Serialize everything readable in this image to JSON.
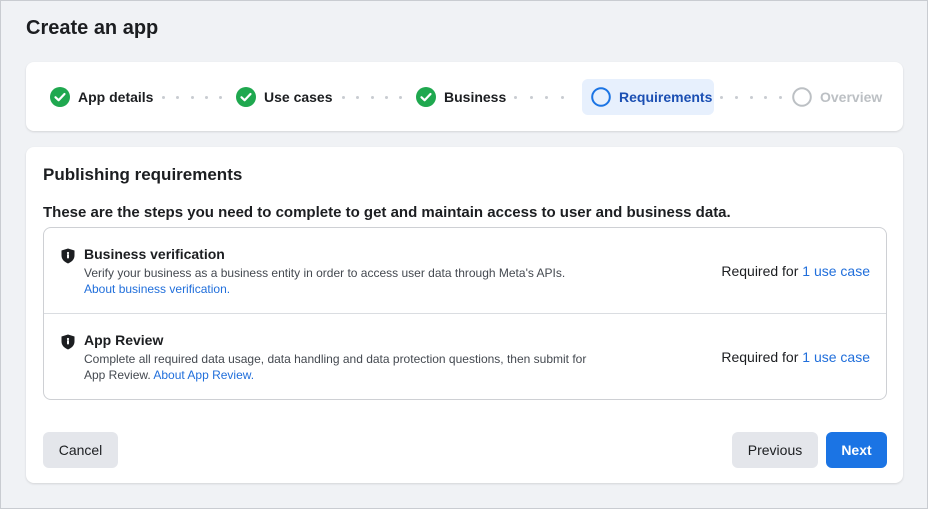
{
  "page": {
    "title": "Create an app"
  },
  "steps": [
    {
      "label": "App details",
      "state": "complete"
    },
    {
      "label": "Use cases",
      "state": "complete"
    },
    {
      "label": "Business",
      "state": "complete"
    },
    {
      "label": "Requirements",
      "state": "active"
    },
    {
      "label": "Overview",
      "state": "pending"
    }
  ],
  "card": {
    "title": "Publishing requirements",
    "subtitle": "These are the steps you need to complete to get and maintain access to user and business data.",
    "requirements": [
      {
        "title": "Business verification",
        "desc_line1": "Verify your business as a business entity in order to access user data through Meta's APIs.",
        "desc_prefix": "",
        "link": "About business verification.",
        "status_prefix": "Required for ",
        "status_link": "1 use case"
      },
      {
        "title": "App Review",
        "desc_line1": "Complete all required data usage, data handling and data protection questions, then submit for",
        "desc_prefix": "App Review. ",
        "link": "About App Review.",
        "status_prefix": "Required for ",
        "status_link": "1 use case"
      }
    ]
  },
  "buttons": {
    "cancel": "Cancel",
    "previous": "Previous",
    "next": "Next"
  },
  "colors": {
    "accent": "#1b74e4",
    "complete": "#1fa84f",
    "link": "#216fdb",
    "active_bg": "#e7f0fd"
  },
  "icons": {
    "complete": "check-circle-icon",
    "active": "circle-outline-icon",
    "requirement": "shield-icon"
  }
}
